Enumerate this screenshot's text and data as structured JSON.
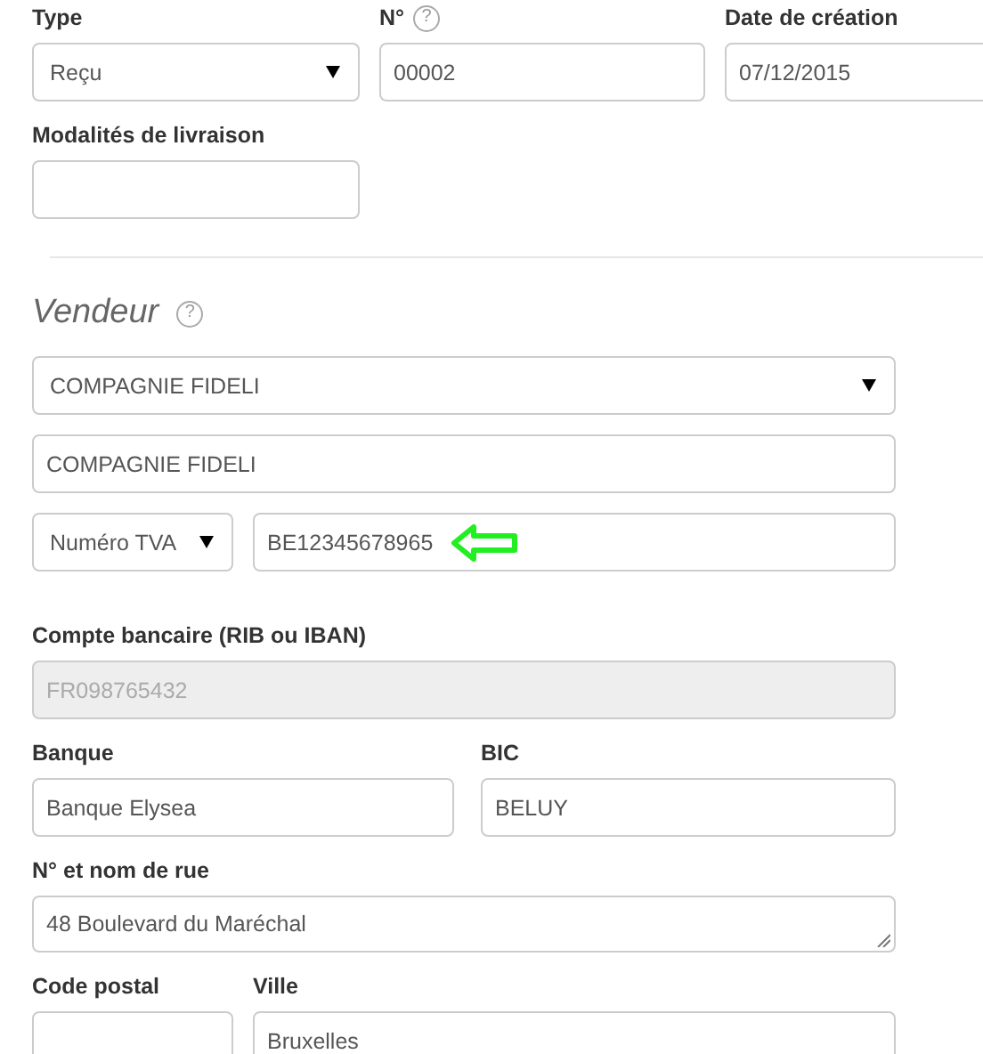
{
  "document": {
    "rows": [
      [
        {
          "label": "Type",
          "kind": "select",
          "value": "Reçu",
          "disabled": false
        },
        {
          "label": "N°",
          "help": "?",
          "kind": "input",
          "value": "00002",
          "disabled": false
        },
        {
          "label": "Date de création",
          "kind": "input",
          "value": "07/12/2015",
          "disabled": false
        }
      ],
      [
        {
          "label": "Modalités de livraison",
          "kind": "input",
          "disabled": false
        }
      ]
    ]
  },
  "seller": {
    "heading": "Vendeur",
    "help": "?",
    "rows": [
      [
        {
          "kind": "select",
          "value": "COMPAGNIE FIDELI",
          "disabled": false
        }
      ],
      [
        {
          "kind": "input",
          "value": "COMPAGNIE FIDELI",
          "disabled": false
        }
      ],
      [
        {
          "kind": "select",
          "value": "Numéro TVA",
          "disabled": false
        },
        {
          "kind": "input",
          "value": "BE12345678965",
          "disabled": false,
          "arrow_marker": true
        }
      ],
      [
        {
          "label": "Compte bancaire (RIB ou IBAN)",
          "kind": "input",
          "value": "FR098765432",
          "disabled": true
        }
      ],
      [
        {
          "label": "Banque",
          "kind": "input",
          "value": "Banque Elysea",
          "disabled": false
        },
        {
          "label": "BIC",
          "kind": "input",
          "value": "BELUY",
          "disabled": false
        }
      ],
      [
        {
          "label": "N° et nom de rue",
          "kind": "textarea",
          "value": "48 Boulevard du Maréchal",
          "disabled": false
        }
      ],
      [
        {
          "label": "Code postal",
          "kind": "input",
          "disabled": false
        },
        {
          "label": "Ville",
          "kind": "input",
          "value": "Bruxelles",
          "disabled": false
        }
      ]
    ]
  }
}
